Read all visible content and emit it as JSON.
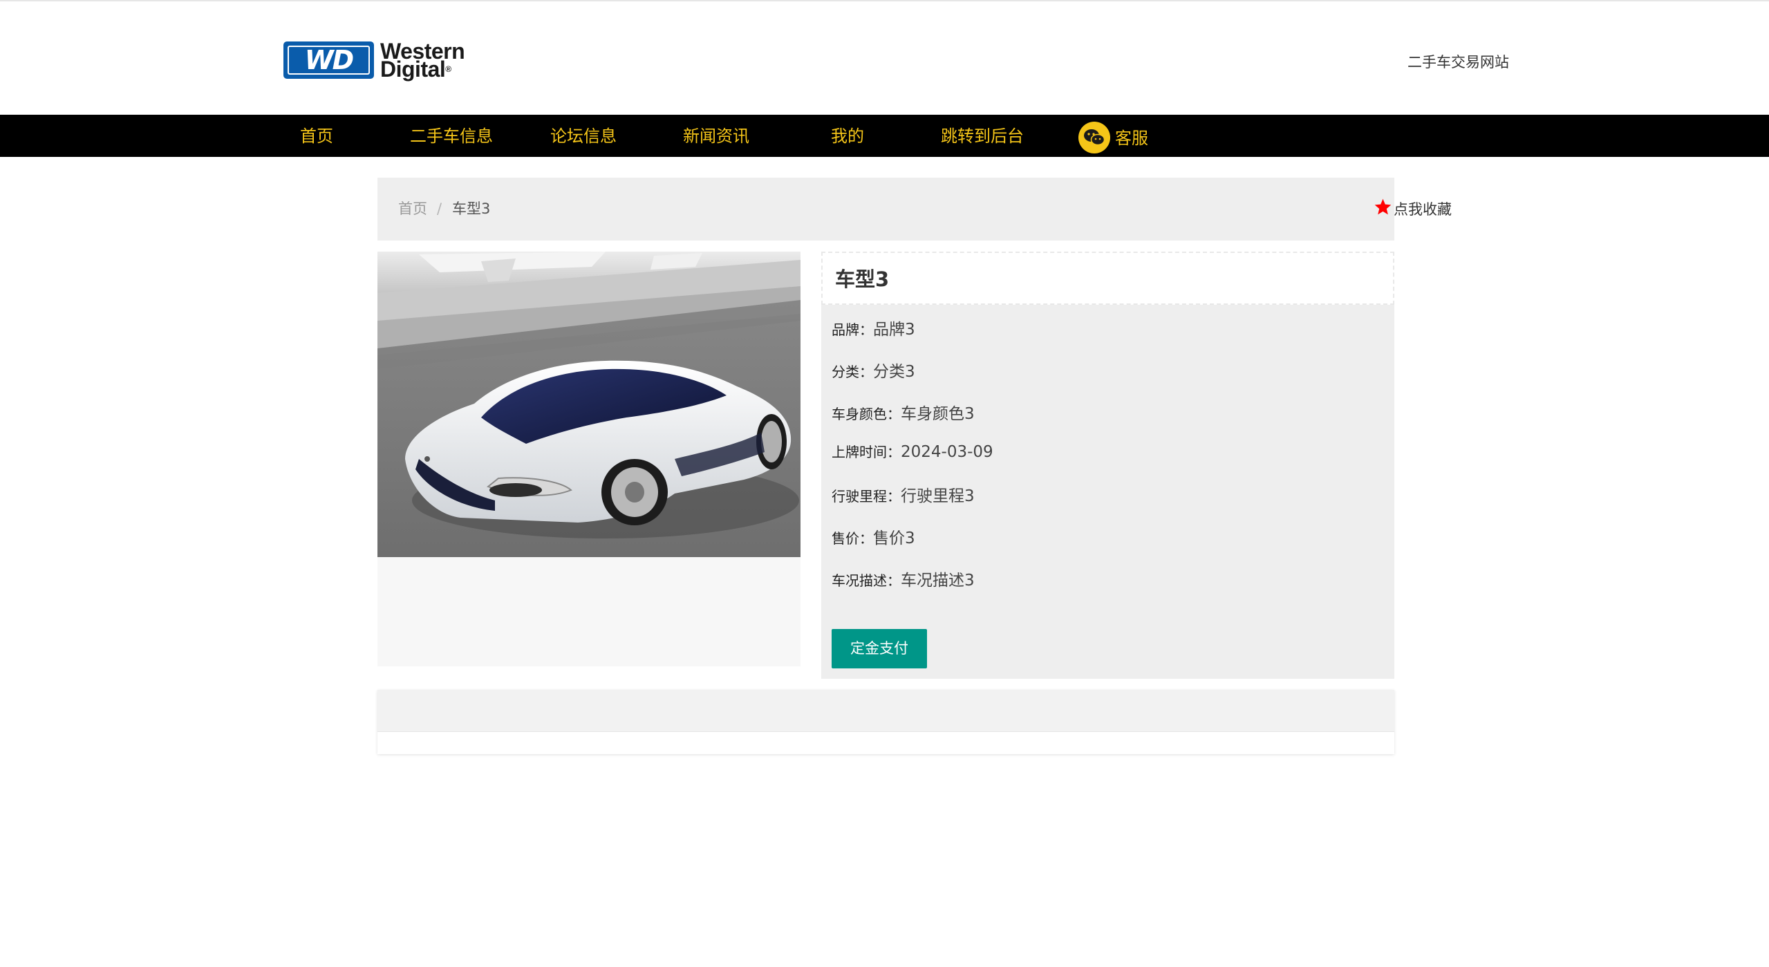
{
  "header": {
    "logo_line1": "Western",
    "logo_line2": "Digital",
    "logo_badge": "WD",
    "logo_reg": "®",
    "site_title": "二手车交易网站"
  },
  "nav": {
    "items": [
      {
        "label": "首页"
      },
      {
        "label": "二手车信息"
      },
      {
        "label": "论坛信息"
      },
      {
        "label": "新闻资讯"
      },
      {
        "label": "我的"
      },
      {
        "label": "跳转到后台"
      }
    ],
    "customer_service": "客服",
    "accent_color": "#f5c518"
  },
  "breadcrumb": {
    "home": "首页",
    "separator": "/",
    "current": "车型3"
  },
  "favorite": {
    "label": "点我收藏",
    "icon": "star-icon",
    "color": "#ff0000"
  },
  "car": {
    "title": "车型3",
    "image_alt": "white concept sports car",
    "fields": [
      {
        "key": "品牌：",
        "value": "品牌3"
      },
      {
        "key": "分类：",
        "value": "分类3"
      },
      {
        "key": "车身颜色：",
        "value": "车身颜色3"
      },
      {
        "key": "上牌时间：",
        "value": "2024-03-09"
      },
      {
        "key": "行驶里程：",
        "value": "行驶里程3"
      },
      {
        "key": "售价：",
        "value": "售价3"
      },
      {
        "key": "车况描述：",
        "value": "车况描述3"
      }
    ],
    "pay_button": "定金支付",
    "pay_color": "#009688"
  }
}
